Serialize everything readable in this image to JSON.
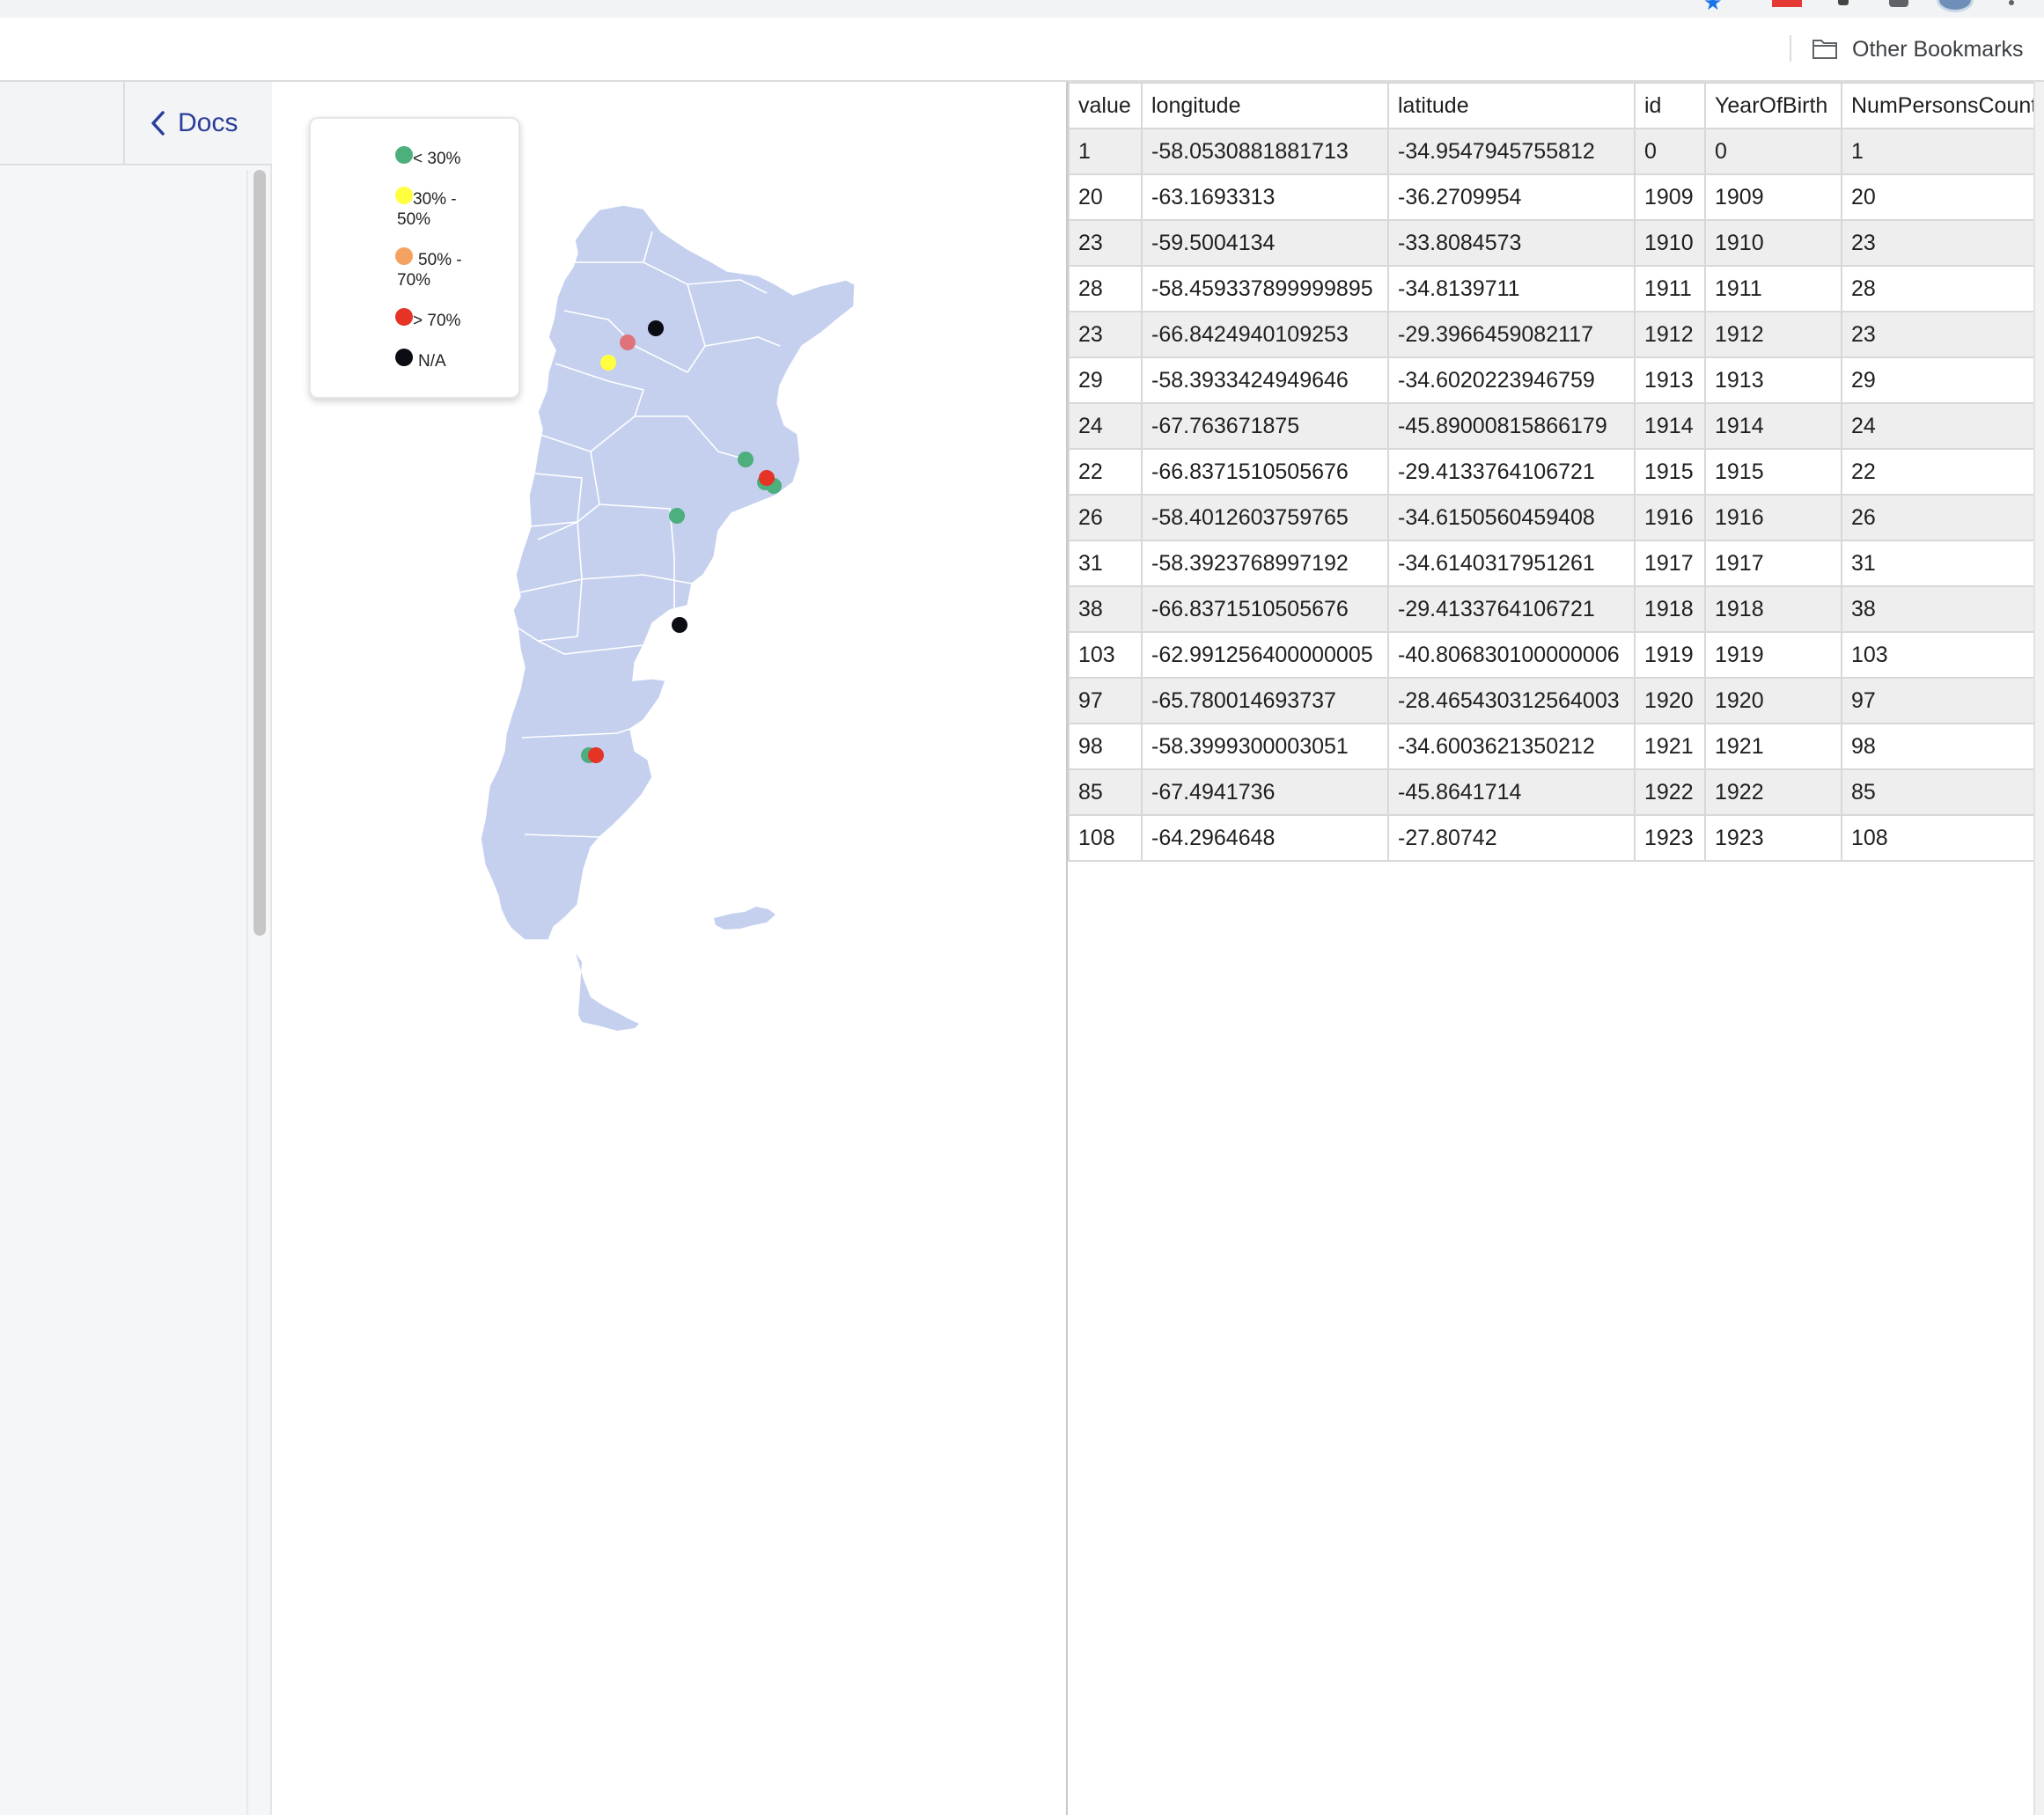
{
  "bookmarks_bar": {
    "other_bookmarks_label": "Other Bookmarks"
  },
  "sidebar": {
    "docs_label": "Docs"
  },
  "colors": {
    "below_30": "#4caf7d",
    "from_30_to_50": "#ffff40",
    "from_50_to_70": "#f4a261",
    "above_70": "#e53325",
    "not_available": "#0c0c14",
    "map_fill": "#c5d0ef"
  },
  "legend": {
    "items": [
      {
        "label": "< 30%",
        "color": "#4caf7d"
      },
      {
        "label": "30% -\n50%",
        "color": "#ffff40"
      },
      {
        "label": "50% -\n70%",
        "color": "#f4a261"
      },
      {
        "label": "> 70%",
        "color": "#e53325"
      },
      {
        "label": "N/A",
        "color": "#0c0c14"
      }
    ]
  },
  "table": {
    "columns": [
      "value",
      "longitude",
      "latitude",
      "id",
      "YearOfBirth",
      "NumPersonsCount"
    ],
    "rows": [
      [
        "1",
        "-58.0530881881713",
        "-34.9547945755812",
        "0",
        "0",
        "1"
      ],
      [
        "20",
        "-63.1693313",
        "-36.2709954",
        "1909",
        "1909",
        "20"
      ],
      [
        "23",
        "-59.5004134",
        "-33.8084573",
        "1910",
        "1910",
        "23"
      ],
      [
        "28",
        "-58.459337899999895",
        "-34.8139711",
        "1911",
        "1911",
        "28"
      ],
      [
        "23",
        "-66.8424940109253",
        "-29.3966459082117",
        "1912",
        "1912",
        "23"
      ],
      [
        "29",
        "-58.3933424949646",
        "-34.6020223946759",
        "1913",
        "1913",
        "29"
      ],
      [
        "24",
        "-67.763671875",
        "-45.89000815866179",
        "1914",
        "1914",
        "24"
      ],
      [
        "22",
        "-66.8371510505676",
        "-29.4133764106721",
        "1915",
        "1915",
        "22"
      ],
      [
        "26",
        "-58.4012603759765",
        "-34.6150560459408",
        "1916",
        "1916",
        "26"
      ],
      [
        "31",
        "-58.3923768997192",
        "-34.6140317951261",
        "1917",
        "1917",
        "31"
      ],
      [
        "38",
        "-66.8371510505676",
        "-29.4133764106721",
        "1918",
        "1918",
        "38"
      ],
      [
        "103",
        "-62.991256400000005",
        "-40.806830100000006",
        "1919",
        "1919",
        "103"
      ],
      [
        "97",
        "-65.780014693737",
        "-28.465430312564003",
        "1920",
        "1920",
        "97"
      ],
      [
        "98",
        "-58.3999300003051",
        "-34.6003621350212",
        "1921",
        "1921",
        "98"
      ],
      [
        "85",
        "-67.4941736",
        "-45.8641714",
        "1922",
        "1922",
        "85"
      ],
      [
        "108",
        "-64.2964648",
        "-27.80742",
        "1923",
        "1923",
        "108"
      ]
    ]
  }
}
